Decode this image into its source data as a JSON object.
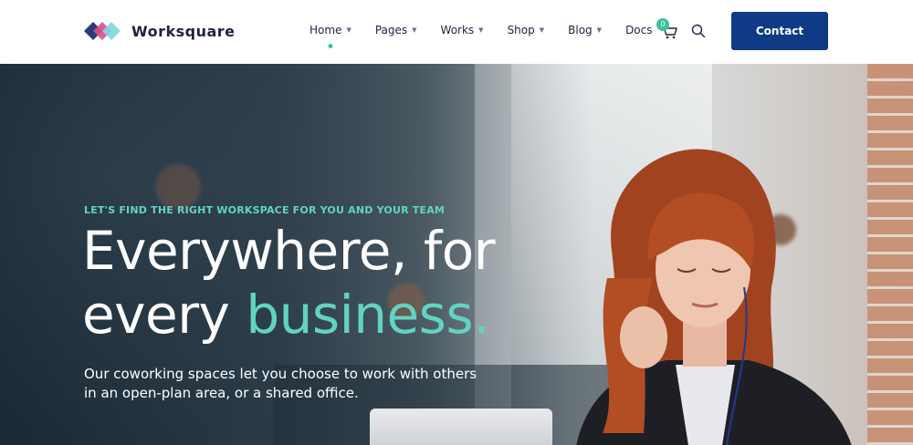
{
  "header": {
    "logo_text": "Worksquare",
    "nav": [
      {
        "label": "Home",
        "has_dropdown": true,
        "active": true
      },
      {
        "label": "Pages",
        "has_dropdown": true,
        "active": false
      },
      {
        "label": "Works",
        "has_dropdown": true,
        "active": false
      },
      {
        "label": "Shop",
        "has_dropdown": true,
        "active": false
      },
      {
        "label": "Blog",
        "has_dropdown": true,
        "active": false
      },
      {
        "label": "Docs",
        "has_dropdown": false,
        "active": false
      }
    ],
    "cart_count": "0",
    "contact_label": "Contact"
  },
  "hero": {
    "kicker": "LET'S FIND THE RIGHT WORKSPACE FOR YOU AND YOUR TEAM",
    "headline_line1": "Everywhere, for",
    "headline_line2_plain": "every ",
    "headline_line2_accent": "business.",
    "subtext": "Our coworking spaces let you choose to work with others in an open-plan area, or a shared office."
  },
  "colors": {
    "accent": "#62d3c3",
    "active_dot": "#3fc29e",
    "button": "#0f3a85",
    "text_dark": "#1c2340"
  },
  "icons": {
    "cart": "cart-icon",
    "search": "search-icon",
    "chevron": "chevron-down-icon"
  }
}
